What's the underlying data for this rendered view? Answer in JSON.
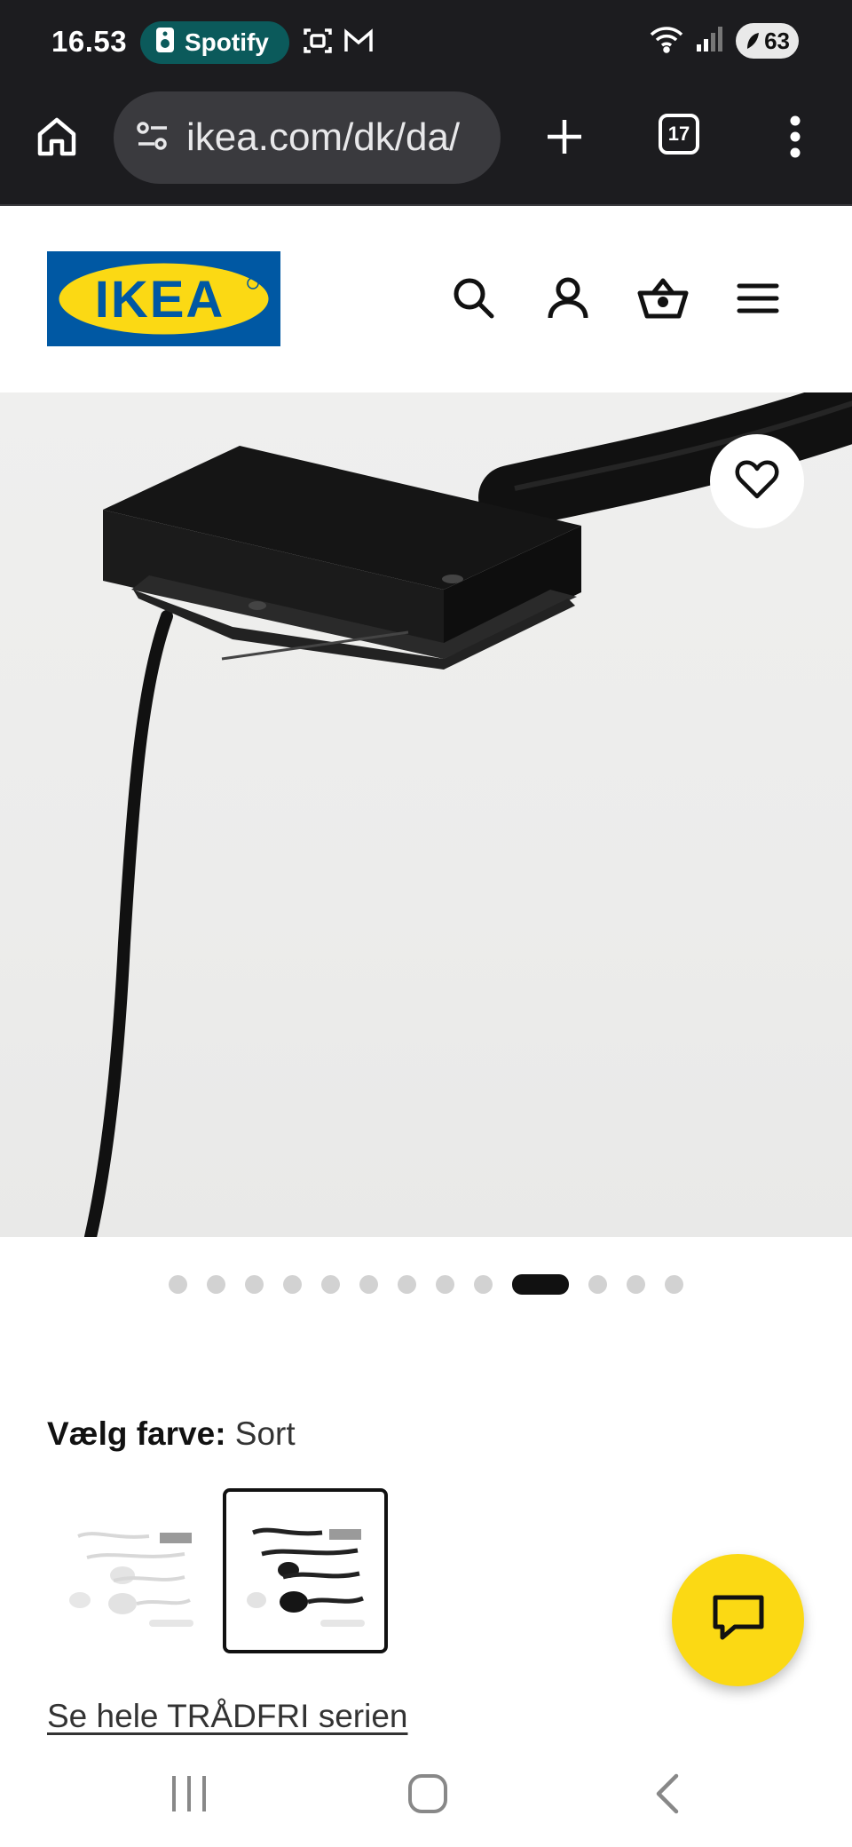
{
  "status_bar": {
    "time": "16.53",
    "notification_app": "Spotify",
    "battery": "63",
    "icons": [
      "spotify-icon",
      "screenshot-icon",
      "gmail-icon",
      "wifi-icon",
      "signal-icon",
      "battery-icon"
    ]
  },
  "browser": {
    "url": "ikea.com/dk/da/",
    "tab_count": "17",
    "icons": [
      "home-icon",
      "site-settings-icon",
      "new-tab-icon",
      "tabs-icon",
      "more-menu-icon"
    ]
  },
  "header": {
    "logo_text": "IKEA",
    "icons": [
      "search-icon",
      "account-icon",
      "basket-icon",
      "menu-icon"
    ]
  },
  "carousel": {
    "total_images": 13,
    "active_index": 9
  },
  "color_picker": {
    "label": "Vælg farve:",
    "selected": "Sort",
    "swatches": [
      "white-variant",
      "black-variant"
    ],
    "selected_index": 1
  },
  "series_link": "Se hele TRÅDFRI serien",
  "colors": {
    "ikea_blue": "#0058a3",
    "ikea_yellow": "#fbd914",
    "browser_dark": "#1c1c1f"
  }
}
